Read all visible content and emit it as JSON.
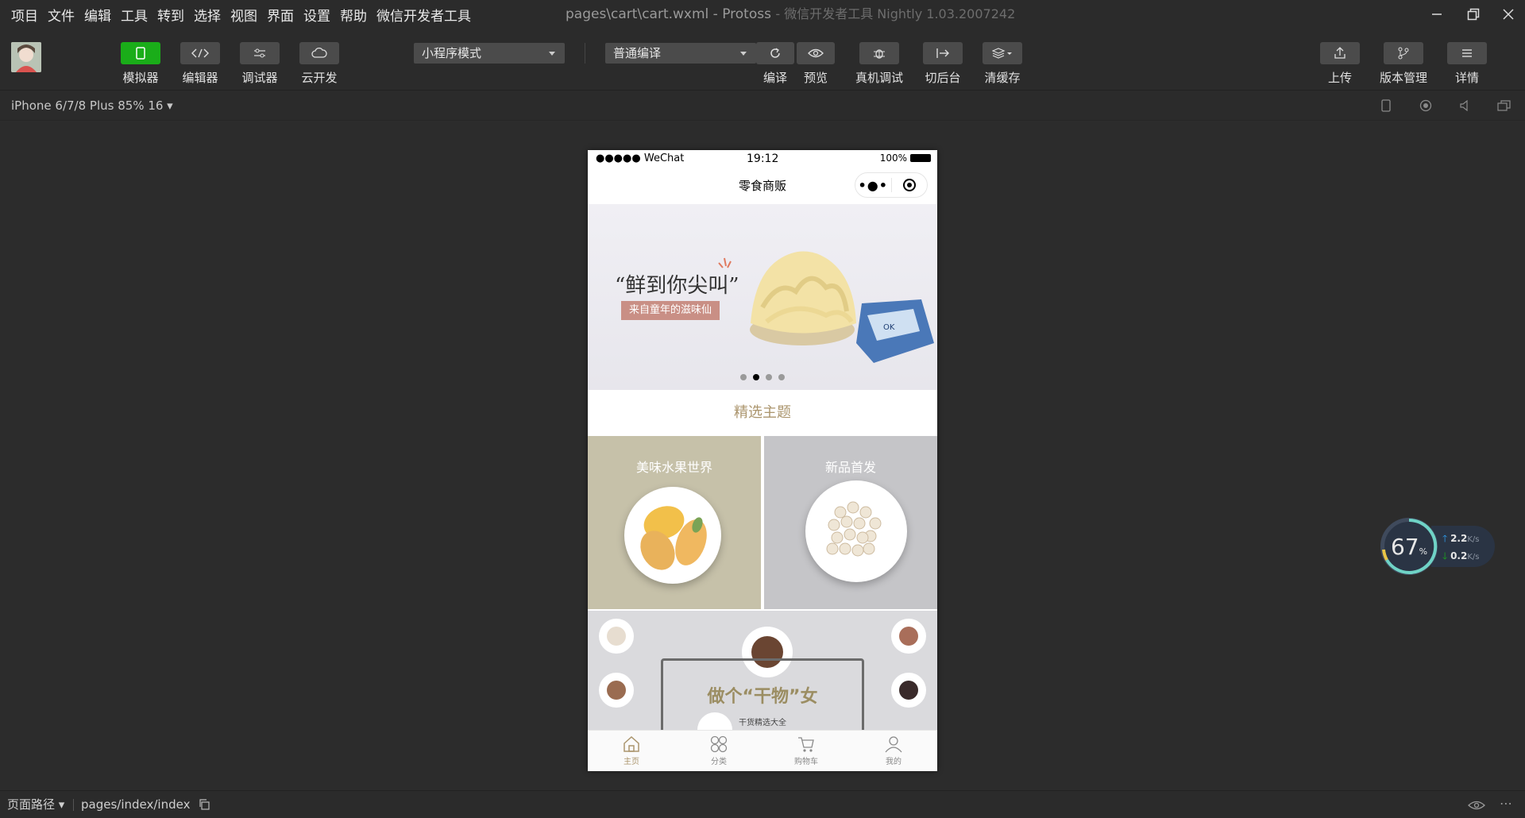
{
  "menu": [
    "项目",
    "文件",
    "编辑",
    "工具",
    "转到",
    "选择",
    "视图",
    "界面",
    "设置",
    "帮助",
    "微信开发者工具"
  ],
  "window": {
    "title": "pages\\cart\\cart.wxml - Protoss",
    "subtitle": "- 微信开发者工具 Nightly 1.03.2007242"
  },
  "toolbar": {
    "simulator": "模拟器",
    "editor": "编辑器",
    "debugger": "调试器",
    "cloud": "云开发",
    "mode_select": "小程序模式",
    "compile_select": "普通编译",
    "compile": "编译",
    "preview": "预览",
    "real_debug": "真机调试",
    "background": "切后台",
    "clear_cache": "清缓存",
    "upload": "上传",
    "version": "版本管理",
    "details": "详情"
  },
  "device": {
    "label": "iPhone 6/7/8 Plus 85% 16 ▾"
  },
  "phone": {
    "status": {
      "signal": "●●●●● WeChat",
      "time": "19:12",
      "battery": "100%"
    },
    "nav_title": "零食商贩",
    "capsule_dots": "•●•",
    "banner": {
      "headline": "“鲜到你尖叫”",
      "tag": "来自童年的滋味仙",
      "active_slide": 2,
      "slides": 4
    },
    "section_title": "精选主题",
    "themes": [
      {
        "title": "美味水果世界",
        "color": "#c6c1a9"
      },
      {
        "title": "新品首发",
        "color": "#c5c5c8"
      }
    ],
    "promo": {
      "title": "做个“干物”女",
      "subtitle": "干货精选大全"
    },
    "tabs": [
      {
        "label": "主页",
        "icon": "home-icon",
        "active": true
      },
      {
        "label": "分类",
        "icon": "category-icon",
        "active": false
      },
      {
        "label": "购物车",
        "icon": "cart-icon",
        "active": false
      },
      {
        "label": "我的",
        "icon": "user-icon",
        "active": false
      }
    ]
  },
  "netmon": {
    "percent": "67",
    "percent_unit": "%",
    "up": "2.2",
    "down": "0.2",
    "unit": "K/s"
  },
  "bottom": {
    "path_label": "页面路径 ▾",
    "path_value": "pages/index/index"
  },
  "colors": {
    "accent": "#1aad19",
    "theme_text": "#ab956d"
  }
}
